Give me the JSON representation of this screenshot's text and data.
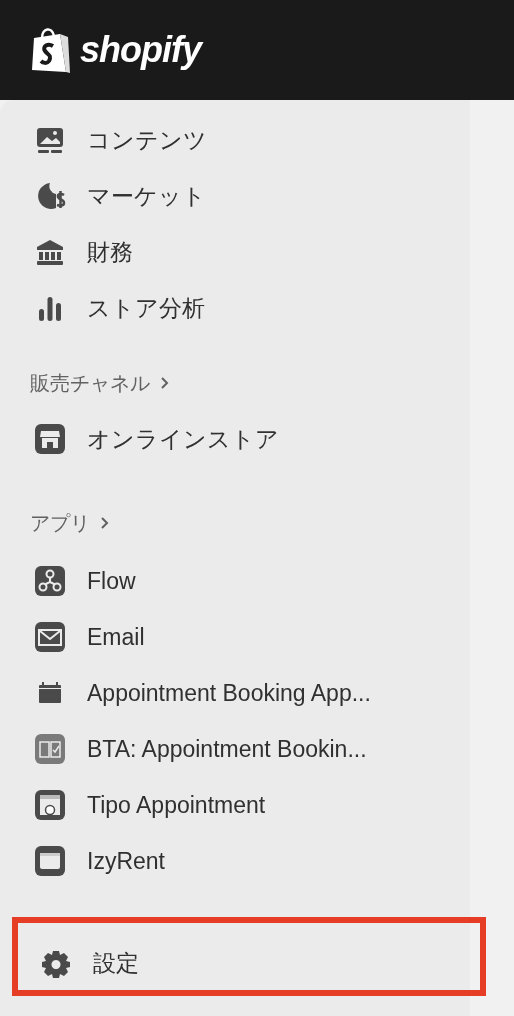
{
  "header": {
    "logo_text": "shopify"
  },
  "sections": [
    {
      "items": [
        {
          "label": "コンテンツ"
        },
        {
          "label": "マーケット"
        },
        {
          "label": "財務"
        },
        {
          "label": "ストア分析"
        }
      ]
    },
    {
      "heading": "販売チャネル",
      "items": [
        {
          "label": "オンラインストア"
        }
      ]
    },
    {
      "heading": "アプリ",
      "items": [
        {
          "label": "Flow"
        },
        {
          "label": "Email"
        },
        {
          "label": "Appointment Booking App..."
        },
        {
          "label": "BTA: Appointment Bookin..."
        },
        {
          "label": "Tipo Appointment"
        },
        {
          "label": "IzyRent"
        }
      ]
    }
  ],
  "settings": {
    "label": "設定",
    "highlighted": true
  }
}
